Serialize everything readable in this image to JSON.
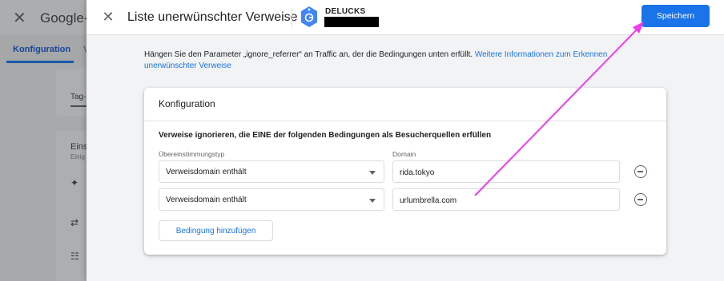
{
  "background": {
    "close_glyph": "✕",
    "title": "Google-T",
    "tab_active": "Konfiguration",
    "tab_other": "V",
    "tag_label": "Tag-",
    "section_title": "Eins",
    "section_sub": "Einig"
  },
  "header": {
    "close_icon": "close-icon",
    "close_glyph": "✕",
    "title": "Liste unerwünschter Verweise",
    "account_icon": "tag-manager-icon",
    "account_name": "DELUCKS",
    "save_label": "Speichern"
  },
  "description": {
    "text": "Hängen Sie den Parameter „ignore_referrer“ an Traffic an, der die Bedingungen unten erfüllt. ",
    "link": "Weitere Informationen zum Erkennen unerwünschter Verweise"
  },
  "config": {
    "title": "Konfiguration",
    "rule_heading": "Verweise ignorieren, die EINE der folgenden Bedingungen als Besucherquellen erfüllen",
    "match_type_label": "Übereinstimmungstyp",
    "domain_label": "Domain",
    "conditions": [
      {
        "match_type": "Verweisdomain enthält",
        "domain": "rida.tokyo"
      },
      {
        "match_type": "Verweisdomain enthält",
        "domain": "urlumbrella.com"
      }
    ],
    "add_condition_label": "Bedingung hinzufügen"
  },
  "colors": {
    "accent": "#1a73e8",
    "annotation_arrow": "#f03cf0"
  }
}
